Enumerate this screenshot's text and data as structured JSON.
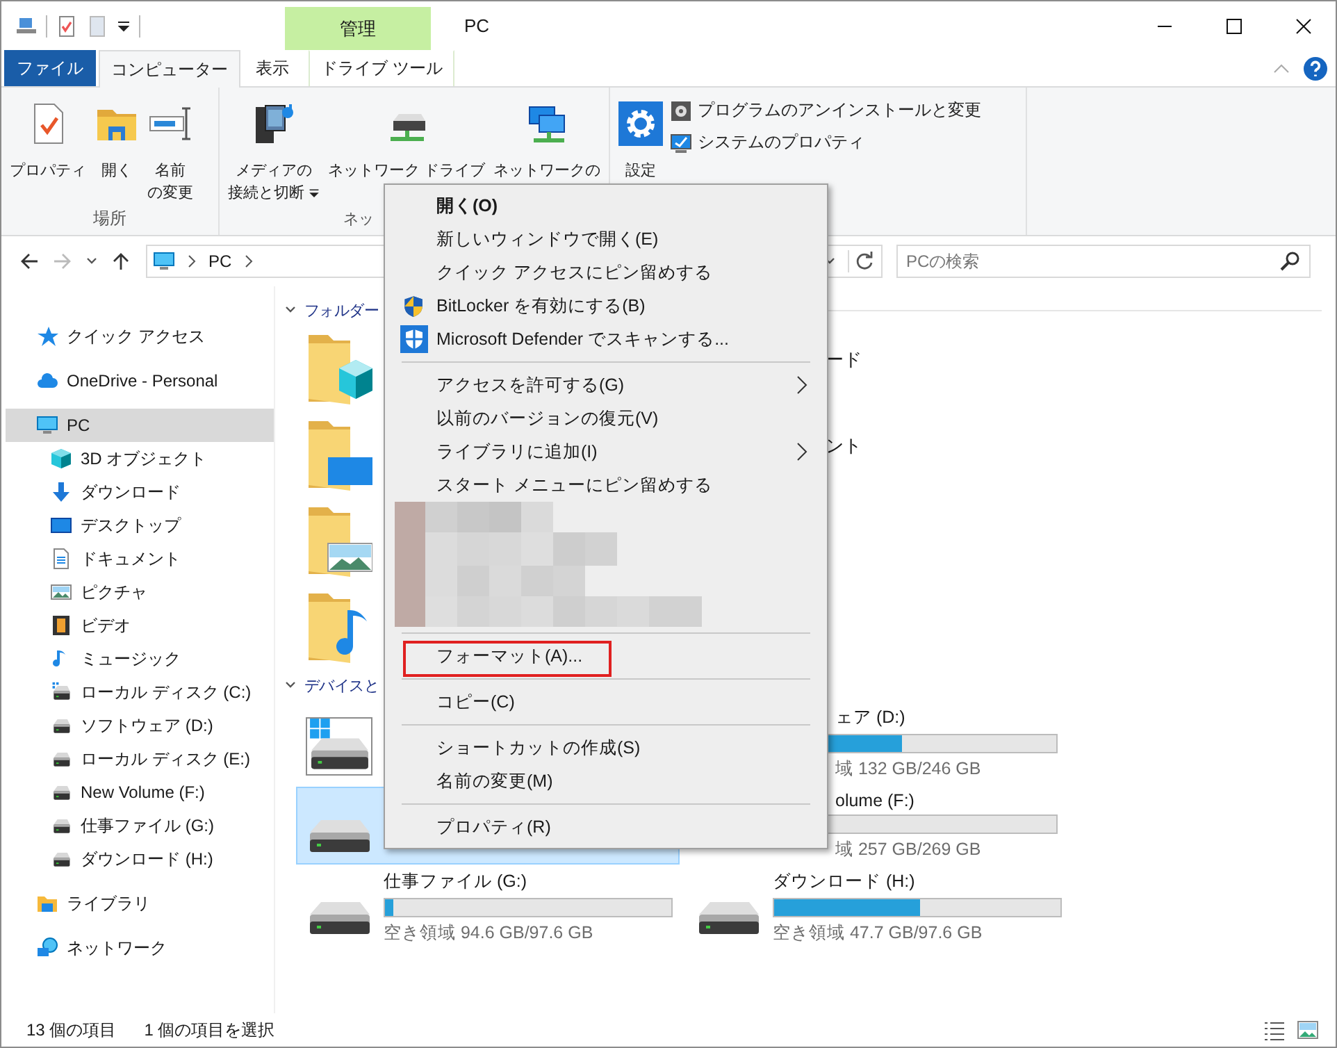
{
  "window": {
    "title": "PC",
    "context_header": "管理"
  },
  "ribbon_tabs": [
    {
      "label": "ファイル",
      "kind": "file",
      "selected": false
    },
    {
      "label": "コンピューター",
      "kind": "tab",
      "selected": true
    },
    {
      "label": "表示",
      "kind": "tab",
      "selected": false
    },
    {
      "label": "ドライブ ツール",
      "kind": "context",
      "selected": false
    }
  ],
  "ribbon_groups": [
    {
      "label": "場所",
      "buttons": [
        {
          "lines": [
            "プロパティ"
          ],
          "dropdown": false
        },
        {
          "lines": [
            "開く"
          ],
          "dropdown": false
        },
        {
          "lines": [
            "名前",
            "の変更"
          ],
          "dropdown": false
        }
      ]
    },
    {
      "label": "ネッ",
      "buttons": [
        {
          "lines": [
            "メディアの",
            "接続と切断"
          ],
          "dropdown": true
        },
        {
          "lines": [
            "ネットワーク ドライブ"
          ],
          "dropdown": false
        },
        {
          "lines": [
            "ネットワークの"
          ],
          "dropdown": false
        }
      ]
    },
    {
      "buttons": [
        {
          "lines": [
            "設定"
          ],
          "dropdown": false
        }
      ],
      "small_buttons": [
        "プログラムのアンインストールと変更",
        "システムのプロパティ"
      ]
    }
  ],
  "address_bar": {
    "crumbs": [
      "PC"
    ]
  },
  "search": {
    "placeholder": "PCの検索"
  },
  "sidebar": {
    "items": [
      {
        "label": "クイック アクセス",
        "selected": false
      },
      {
        "label": "OneDrive - Personal",
        "selected": false
      },
      {
        "label": "PC",
        "selected": true,
        "children": [
          {
            "label": "3D オブジェクト",
            "selected": false
          },
          {
            "label": "ダウンロード",
            "selected": false
          },
          {
            "label": "デスクトップ",
            "selected": false
          },
          {
            "label": "ドキュメント",
            "selected": false
          },
          {
            "label": "ピクチャ",
            "selected": false
          },
          {
            "label": "ビデオ",
            "selected": false
          },
          {
            "label": "ミュージック",
            "selected": false
          },
          {
            "label": "ローカル ディスク (C:)",
            "selected": false
          },
          {
            "label": "ソフトウェア (D:)",
            "selected": false
          },
          {
            "label": "ローカル ディスク (E:)",
            "selected": false
          },
          {
            "label": "New Volume (F:)",
            "selected": false
          },
          {
            "label": "仕事ファイル (G:)",
            "selected": false
          },
          {
            "label": "ダウンロード (H:)",
            "selected": false
          }
        ]
      },
      {
        "label": "ライブラリ",
        "selected": false
      },
      {
        "label": "ネットワーク",
        "selected": false
      }
    ]
  },
  "content": {
    "folders_header": "フォルダー",
    "folder_rows": [
      {
        "left": {
          "kind": "covered"
        },
        "right": {
          "kind": "peek",
          "name": "ード"
        }
      },
      {
        "left": {
          "kind": "covered"
        },
        "right": {
          "kind": "peek",
          "name": "ント"
        }
      },
      {
        "left": {
          "kind": "covered"
        }
      },
      {
        "left": {
          "kind": "covered"
        }
      }
    ],
    "devices_header": "デバイスと",
    "drives": [
      {
        "kind": "covered",
        "selected": false
      },
      {
        "kind": "peek",
        "selected": false,
        "name": "ェア (D:)",
        "level": 0.46,
        "free": "域 132 GB/246 GB"
      },
      {
        "kind": "covered",
        "selected": true
      },
      {
        "kind": "peek",
        "selected": false,
        "name": "olume (F:)",
        "free": "域 257 GB/269 GB"
      },
      {
        "kind": "full",
        "selected": false,
        "name": "仕事ファイル (G:)",
        "level": 0.03,
        "free": "空き領域 94.6 GB/97.6 GB"
      },
      {
        "kind": "full",
        "selected": false,
        "name": "ダウンロード (H:)",
        "level": 0.51,
        "free": "空き領域 47.7 GB/97.6 GB"
      }
    ]
  },
  "context_menu": {
    "items": [
      {
        "kind": "item",
        "label": "開く(O)",
        "default": true,
        "highlighted": false
      },
      {
        "kind": "item",
        "label": "新しいウィンドウで開く(E)",
        "default": false,
        "highlighted": false
      },
      {
        "kind": "item",
        "label": "クイック アクセスにピン留めする",
        "default": false,
        "highlighted": false
      },
      {
        "kind": "item",
        "label": "BitLocker を有効にする(B)",
        "default": false,
        "highlighted": false
      },
      {
        "kind": "item",
        "label": "Microsoft Defender でスキャンする...",
        "default": false,
        "highlighted": false
      },
      {
        "kind": "separator"
      },
      {
        "kind": "submenu",
        "label": "アクセスを許可する(G)",
        "default": false,
        "highlighted": false
      },
      {
        "kind": "item",
        "label": "以前のバージョンの復元(V)",
        "default": false,
        "highlighted": false
      },
      {
        "kind": "submenu",
        "label": "ライブラリに追加(I)",
        "default": false,
        "highlighted": false
      },
      {
        "kind": "item",
        "label": "スタート メニューにピン留めする",
        "default": false,
        "highlighted": false
      },
      {
        "kind": "redacted"
      },
      {
        "kind": "separator"
      },
      {
        "kind": "item",
        "label": "フォーマット(A)...",
        "default": false,
        "highlighted": true
      },
      {
        "kind": "separator"
      },
      {
        "kind": "item",
        "label": "コピー(C)",
        "default": false,
        "highlighted": false
      },
      {
        "kind": "separator"
      },
      {
        "kind": "item",
        "label": "ショートカットの作成(S)",
        "default": false,
        "highlighted": false
      },
      {
        "kind": "item",
        "label": "名前の変更(M)",
        "default": false,
        "highlighted": false
      },
      {
        "kind": "separator"
      },
      {
        "kind": "item",
        "label": "プロパティ(R)",
        "default": false,
        "highlighted": false
      }
    ]
  },
  "status_bar": [
    "13 個の項目",
    "1 個の項目を選択"
  ]
}
